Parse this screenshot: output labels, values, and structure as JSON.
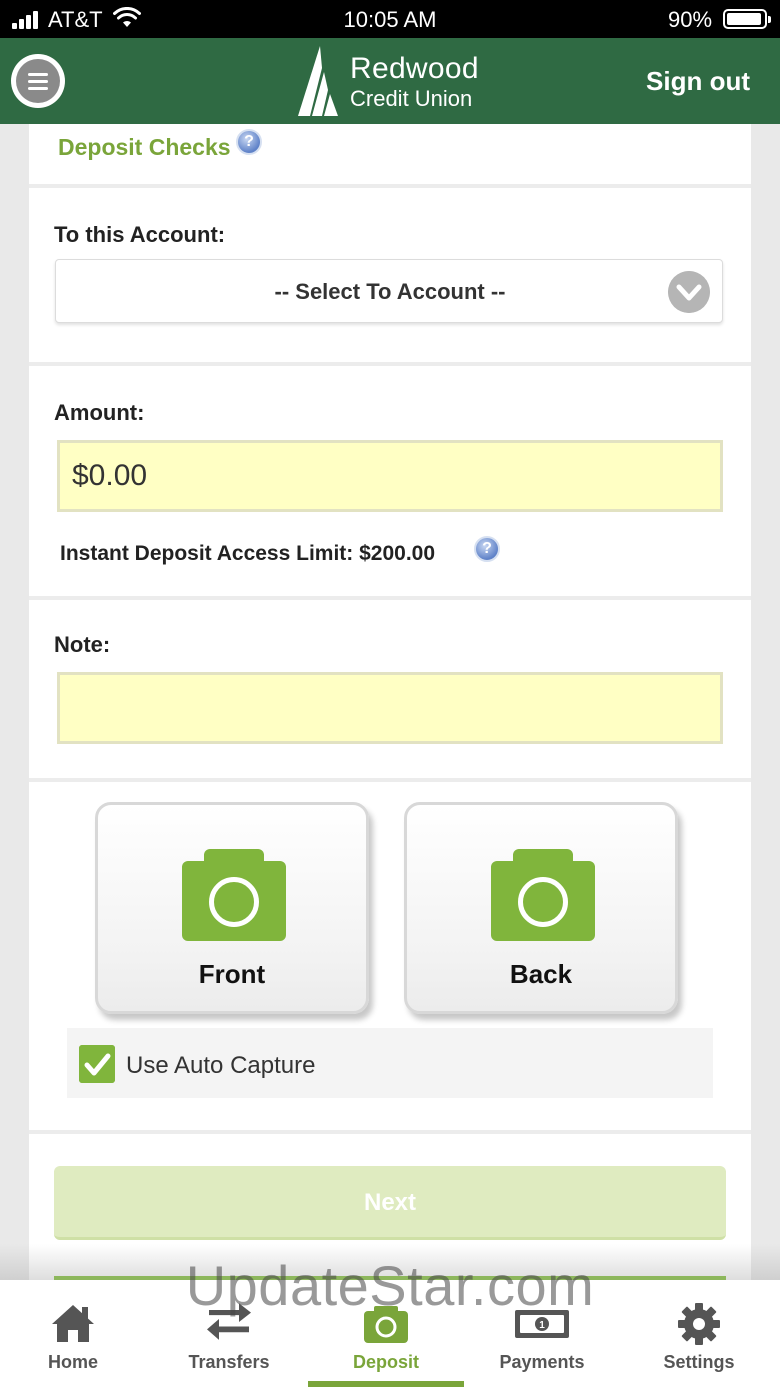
{
  "status_bar": {
    "carrier": "AT&T",
    "time": "10:05 AM",
    "battery": "90%",
    "battery_level": 0.9
  },
  "header": {
    "logo_line1": "Redwood",
    "logo_line2": "Credit Union",
    "sign_out": "Sign out",
    "brand_color": "#2f6a43"
  },
  "deposit": {
    "title": "Deposit Checks",
    "help_glyph": "?",
    "to_account_label": "To this Account:",
    "to_account_value": "-- Select To Account --",
    "amount_label": "Amount:",
    "amount_value": "$0.00",
    "limit_text": "Instant Deposit Access Limit: $200.00",
    "note_label": "Note:",
    "note_value": "",
    "front_label": "Front",
    "back_label": "Back",
    "auto_capture_label": "Use Auto Capture",
    "auto_capture_checked": true,
    "next_label": "Next",
    "accent_color": "#7aa53a"
  },
  "tabs": [
    {
      "label": "Home",
      "icon": "home-icon"
    },
    {
      "label": "Transfers",
      "icon": "transfers-icon"
    },
    {
      "label": "Deposit",
      "icon": "camera-icon",
      "active": true
    },
    {
      "label": "Payments",
      "icon": "cash-icon"
    },
    {
      "label": "Settings",
      "icon": "gear-icon"
    }
  ],
  "watermark": "UpdateStar.com"
}
